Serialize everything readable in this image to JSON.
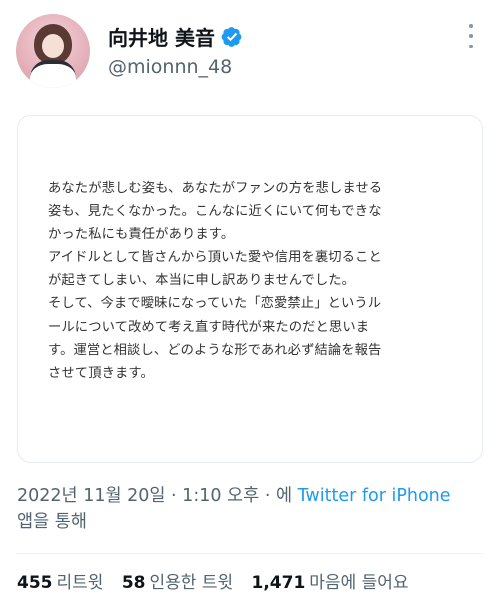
{
  "author": {
    "display_name": "向井地 美音",
    "handle": "@mionnn_48",
    "verified_icon": "verified-badge-icon",
    "verified_color": "#1d9bf0"
  },
  "menu_icon": "more-dots-icon",
  "image_text_lines": [
    "あなたが悲しむ姿も、あなたがファンの方を悲しませる",
    "姿も、見たくなかった。こんなに近くにいて何もできな",
    "かった私にも責任があります。",
    "アイドルとして皆さんから頂いた愛や信用を裏切ること",
    "が起きてしまい、本当に申し訳ありませんでした。",
    "そして、今まで曖昧になっていた「恋愛禁止」というル",
    "ールについて改めて考え直す時代が来たのだと思いま",
    "す。運営と相談し、どのような形であれ必ず結論を報告",
    "させて頂きます。"
  ],
  "meta": {
    "timestamp": "2022년 11월 20일 · 1:10 오후",
    "via_prefix": "· 에 ",
    "source": "Twitter for iPhone",
    "via_suffix": "앱을 통해"
  },
  "stats": {
    "retweets_count": "455",
    "retweets_label": "리트윗",
    "quotes_count": "58",
    "quotes_label": "인용한 트윗",
    "likes_count": "1,471",
    "likes_label": "마음에 들어요"
  }
}
